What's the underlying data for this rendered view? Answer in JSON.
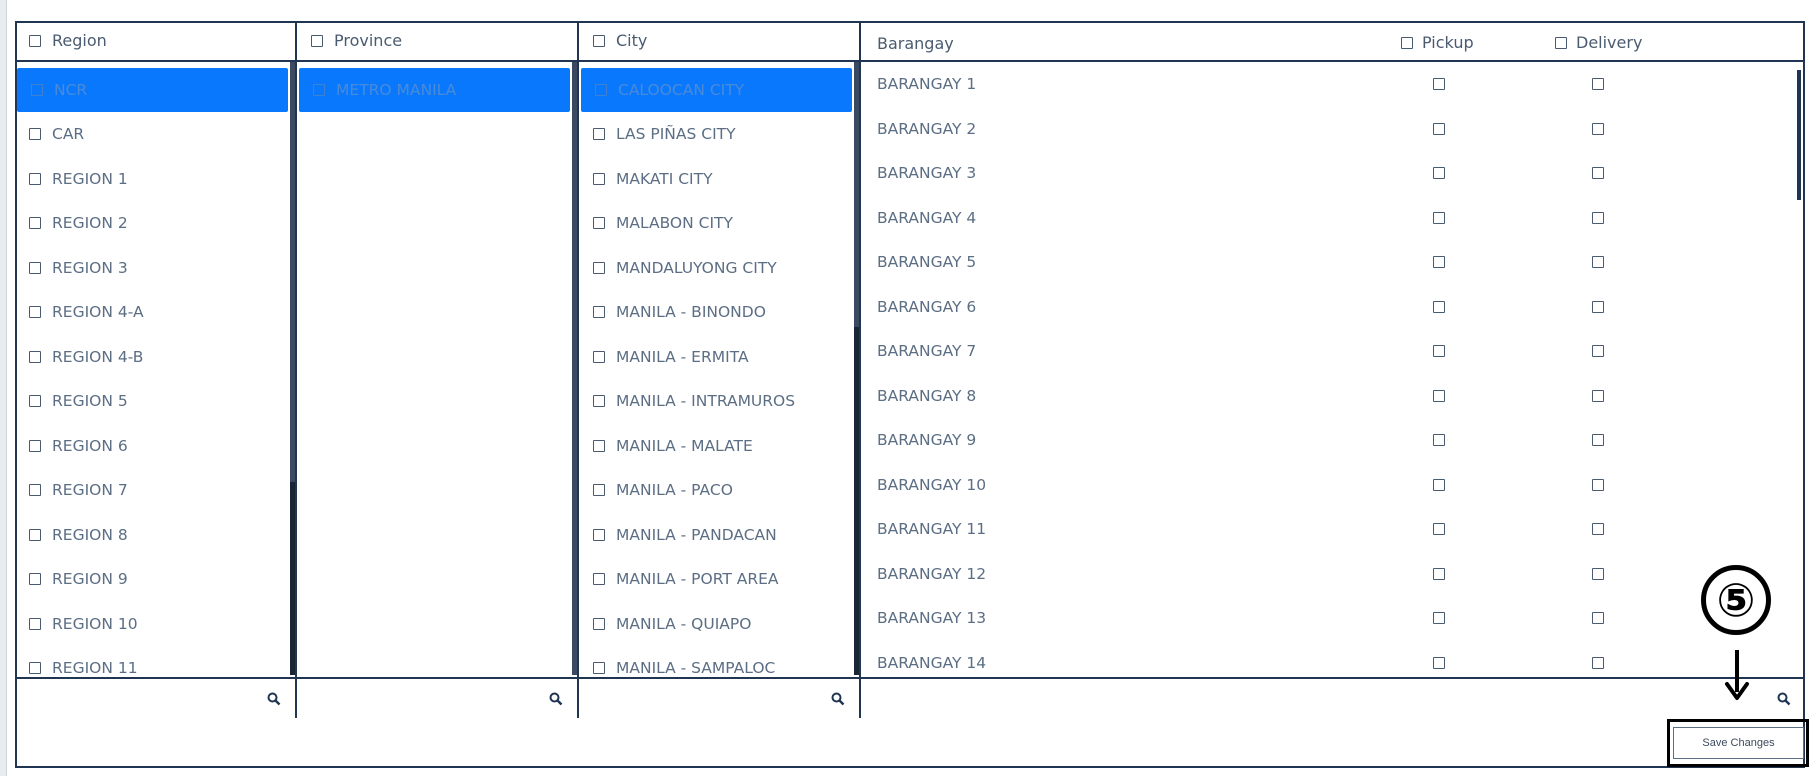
{
  "columns": {
    "region": {
      "header": "Region",
      "items": [
        "NCR",
        "CAR",
        "REGION 1",
        "REGION 2",
        "REGION 3",
        "REGION 4-A",
        "REGION 4-B",
        "REGION 5",
        "REGION 6",
        "REGION 7",
        "REGION 8",
        "REGION 9",
        "REGION 10",
        "REGION 11"
      ],
      "selected": "NCR"
    },
    "province": {
      "header": "Province",
      "items": [
        "METRO MANILA"
      ],
      "selected": "METRO MANILA"
    },
    "city": {
      "header": "City",
      "items": [
        "CALOOCAN CITY",
        "LAS PIÑAS CITY",
        "MAKATI CITY",
        "MALABON CITY",
        "MANDALUYONG CITY",
        "MANILA - BINONDO",
        "MANILA - ERMITA",
        "MANILA - INTRAMUROS",
        "MANILA - MALATE",
        "MANILA - PACO",
        "MANILA - PANDACAN",
        "MANILA - PORT AREA",
        "MANILA - QUIAPO",
        "MANILA - SAMPALOC"
      ],
      "selected": "CALOOCAN CITY"
    },
    "barangay": {
      "header": "Barangay",
      "pickup_label": "Pickup",
      "delivery_label": "Delivery",
      "items": [
        "BARANGAY 1",
        "BARANGAY 2",
        "BARANGAY 3",
        "BARANGAY 4",
        "BARANGAY 5",
        "BARANGAY 6",
        "BARANGAY 7",
        "BARANGAY 8",
        "BARANGAY 9",
        "BARANGAY 10",
        "BARANGAY 11",
        "BARANGAY 12",
        "BARANGAY 13",
        "BARANGAY 14"
      ]
    }
  },
  "footer": {
    "save_label": "Save Changes"
  },
  "annotation": {
    "step_label": "⑤"
  },
  "colors": {
    "selected_bg": "#0a78fd",
    "border": "#1f3552",
    "text": "#5c6e84"
  },
  "icons": {
    "search": "search-icon",
    "checkbox": "checkbox-icon",
    "arrow": "arrow-down-icon"
  }
}
